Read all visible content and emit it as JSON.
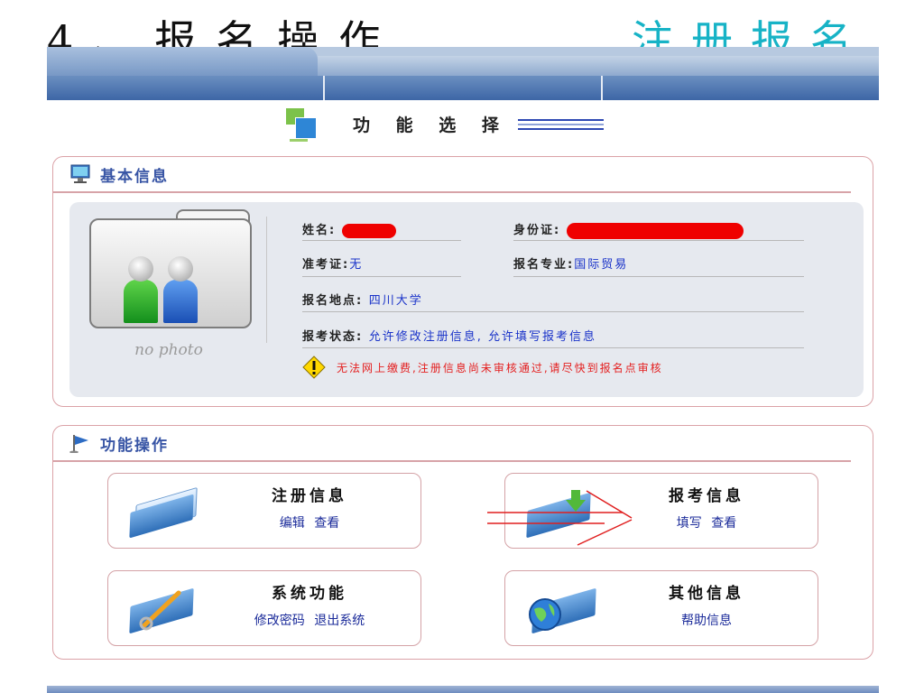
{
  "slide_title": {
    "left": "4、报名操作",
    "right": "注册报名程序"
  },
  "header": {
    "title": "功 能 选 择"
  },
  "basic_info": {
    "section_title": "基本信息",
    "photo_label": "no photo",
    "name_label": "姓名:",
    "id_label": "身份证:",
    "exam_no_label": "准考证:",
    "exam_no_value": "无",
    "major_label": "报名专业:",
    "major_value": "国际贸易",
    "location_label": "报名地点:",
    "location_value": "四川大学",
    "status_label": "报考状态:",
    "status_value": "允许修改注册信息, 允许填写报考信息",
    "warning": "无法网上缴费,注册信息尚未审核通过,请尽快到报名点审核"
  },
  "operations": {
    "section_title": "功能操作",
    "buttons": [
      {
        "title": "注册信息",
        "links": [
          "编辑",
          "查看"
        ]
      },
      {
        "title": "报考信息",
        "links": [
          "填写",
          "查看"
        ]
      },
      {
        "title": "系统功能",
        "links": [
          "修改密码",
          "退出系统"
        ]
      },
      {
        "title": "其他信息",
        "links": [
          "帮助信息"
        ]
      }
    ]
  },
  "colors": {
    "accent_blue": "#3855a5",
    "link_blue": "#1b2b9a",
    "warning_red": "#e42020",
    "border_pink": "#dba2a7"
  }
}
